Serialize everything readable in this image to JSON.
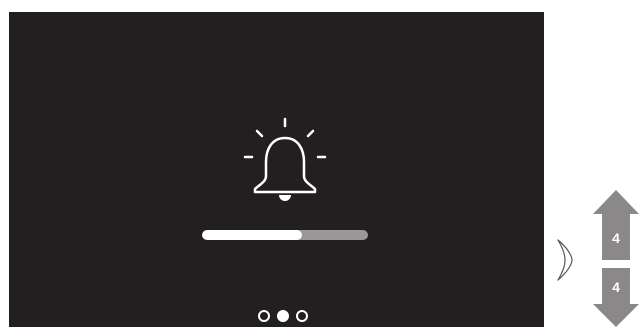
{
  "screen": {
    "icon": "bell-icon",
    "background_color": "#231f20",
    "volume": {
      "level_fraction": 0.6,
      "fill_color": "#ffffff",
      "track_color": "#9a9899"
    },
    "pagination": {
      "count": 3,
      "active_index": 1
    }
  },
  "side_handle": {
    "icon": "chevron-right-icon"
  },
  "arrows": {
    "up_label": "4",
    "down_label": "4",
    "color": "#8a8889"
  }
}
